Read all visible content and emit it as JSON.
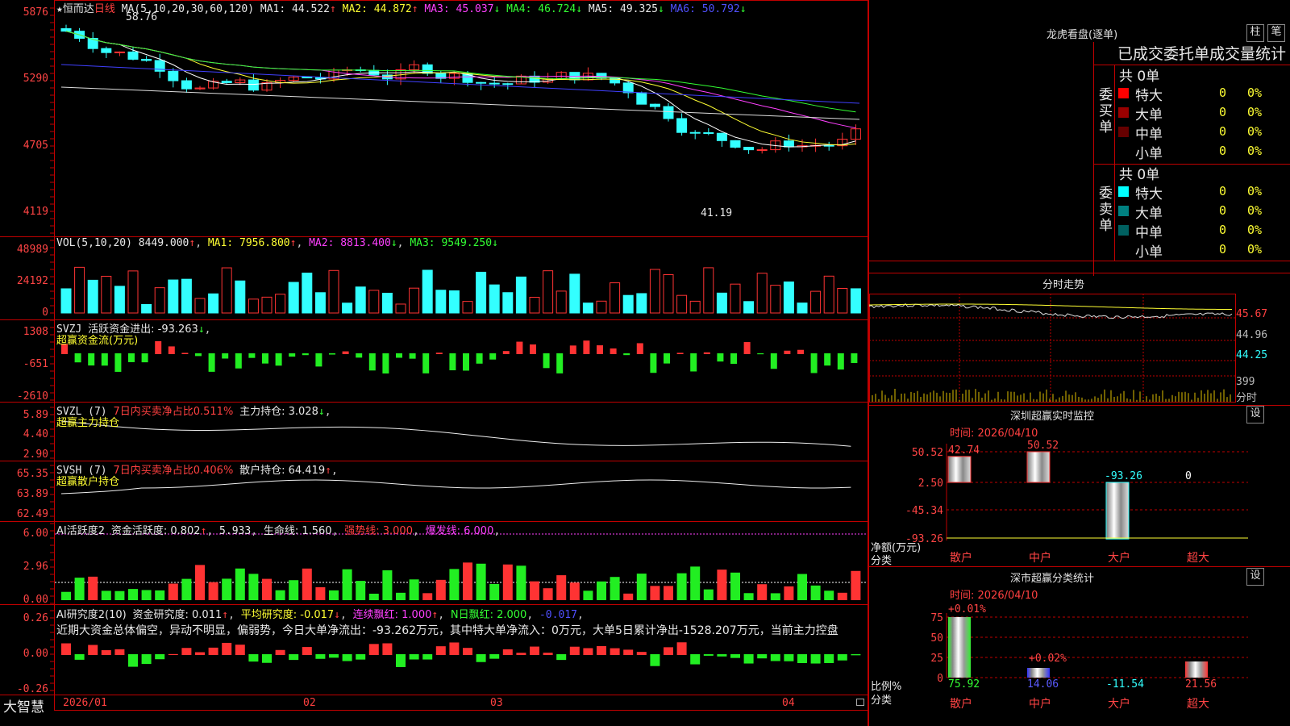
{
  "header": {
    "star": "★",
    "stock_name": "恒而达",
    "period": "日线",
    "ma_label": "MA(5,10,20,30,60,120)",
    "ma1": "MA1: 44.522",
    "ma2": "MA2: 44.872",
    "ma3": "MA3: 45.037",
    "ma4": "MA4: 46.724",
    "ma5": "MA5: 49.325",
    "ma6": "MA6: 50.792",
    "ma1_arrow": "↑",
    "ma2_arrow": "↑",
    "ma3_arrow": "↓",
    "ma4_arrow": "↓",
    "ma5_arrow": "↓",
    "ma6_arrow": "↓",
    "high_mark": "58.76",
    "low_mark": "41.19"
  },
  "price_axis": [
    "5876",
    "5290",
    "4705",
    "4119"
  ],
  "vol": {
    "label": "VOL(5,10,20)",
    "value": "8449.000",
    "ma1": "MA1: 7956.800",
    "ma2": "MA2: 8813.400",
    "ma3": "MA3: 9549.250",
    "axis": [
      "48989",
      "24192",
      "0"
    ],
    "value_arrow": "↑",
    "ma1_arrow": "↑",
    "ma2_arrow": "↓",
    "ma3_arrow": "↓"
  },
  "svzj": {
    "label": "SVZJ",
    "title": "活跃资金进出: -93.263",
    "title_arrow": "↓",
    "subtitle": "超赢资金流(万元)",
    "axis": [
      "1308",
      "-651",
      "-2610"
    ]
  },
  "svzl": {
    "label": "SVZL (7)",
    "ratio": "7日内买卖净占比0.511%",
    "hold": "主力持仓: 3.028",
    "hold_arrow": "↓",
    "subtitle": "超赢主力持仓",
    "axis": [
      "5.89",
      "4.40",
      "2.90"
    ]
  },
  "svsh": {
    "label": "SVSH (7)",
    "ratio": "7日内买卖净占比0.406%",
    "hold": "散户持仓: 64.419",
    "hold_arrow": "↑",
    "subtitle": "超赢散户持仓",
    "axis": [
      "65.35",
      "63.89",
      "62.49"
    ]
  },
  "ai_active": {
    "label": "AI活跃度2",
    "v1": "资金活跃度: 0.802",
    "v1_arrow": "↑",
    "v2": "5.933",
    "v3": "生命线: 1.560",
    "v4": "强势线: 3.000",
    "v5": "爆发线: 6.000",
    "axis": [
      "6.00",
      "2.96",
      "0.00"
    ]
  },
  "ai_research": {
    "label": "AI研究度2(10)",
    "v1": "资金研究度: 0.011",
    "v1_arrow": "↑",
    "v2": "平均研究度: -0.017",
    "v2_arrow": "↓",
    "v3": "连续飘红: 1.000",
    "v3_arrow": "↑",
    "v4": "N日飘红: 2.000",
    "v5": "-0.017",
    "axis": [
      "0.26",
      "0.00",
      "-0.26"
    ],
    "comment": "近期大资金总体偏空，异动不明显，偏弱势，今日大单净流出：-93.262万元，其中特大单净流入：0万元，大单5日累计净出-1528.207万元，当前主力控盘"
  },
  "time_axis": [
    "2026/01",
    "02",
    "03",
    "04"
  ],
  "footer": {
    "brand": "大智慧"
  },
  "dragon": {
    "title": "龙虎看盘(逐单)",
    "btn1": "柱",
    "btn2": "笔",
    "header": "已成交委托单成交量统计",
    "buy": {
      "side_label": "委买单",
      "total": "共 0单",
      "rows": [
        {
          "name": "特大",
          "vol": "0",
          "pct": "0%",
          "color": "#ff0000"
        },
        {
          "name": "大单",
          "vol": "0",
          "pct": "0%",
          "color": "#990000"
        },
        {
          "name": "中单",
          "vol": "0",
          "pct": "0%",
          "color": "#660000"
        },
        {
          "name": "小单",
          "vol": "0",
          "pct": "0%",
          "color": ""
        }
      ]
    },
    "sell": {
      "side_label": "委卖单",
      "total": "共 0单",
      "rows": [
        {
          "name": "特大",
          "vol": "0",
          "pct": "0%",
          "color": "#00ffff"
        },
        {
          "name": "大单",
          "vol": "0",
          "pct": "0%",
          "color": "#008080"
        },
        {
          "name": "中单",
          "vol": "0",
          "pct": "0%",
          "color": "#006060"
        },
        {
          "name": "小单",
          "vol": "0",
          "pct": "0%",
          "color": ""
        }
      ]
    }
  },
  "fenshi": {
    "title": "分时走势",
    "axis": [
      "45.67",
      "44.96",
      "44.25"
    ],
    "vol_label": "399",
    "unit": "分时"
  },
  "monitor": {
    "title": "深圳超赢实时监控",
    "btn": "设",
    "time": "时间: 2026/04/10",
    "axis": [
      "50.52",
      "2.50",
      "-45.34",
      "-93.26"
    ],
    "y_title": "净额(万元)",
    "x_title": "分类",
    "categories": [
      "散户",
      "中户",
      "大户",
      "超大"
    ],
    "values": [
      "42.74",
      "50.52",
      "-93.26",
      "0"
    ]
  },
  "classify": {
    "title": "深市超赢分类统计",
    "btn": "设",
    "time": "时间: 2026/04/10",
    "axis": [
      "75",
      "50",
      "25",
      "0"
    ],
    "y_title": "比例%",
    "x_title": "分类",
    "categories": [
      "散户",
      "中户",
      "大户",
      "超大"
    ],
    "tops": [
      "+0.01%",
      "+0.02%",
      "",
      ""
    ],
    "values": [
      "75.92",
      "14.06",
      "-11.54",
      "21.56"
    ]
  },
  "colors": {
    "up": "#ff3333",
    "down": "#33ffff",
    "grid": "#c00000"
  }
}
